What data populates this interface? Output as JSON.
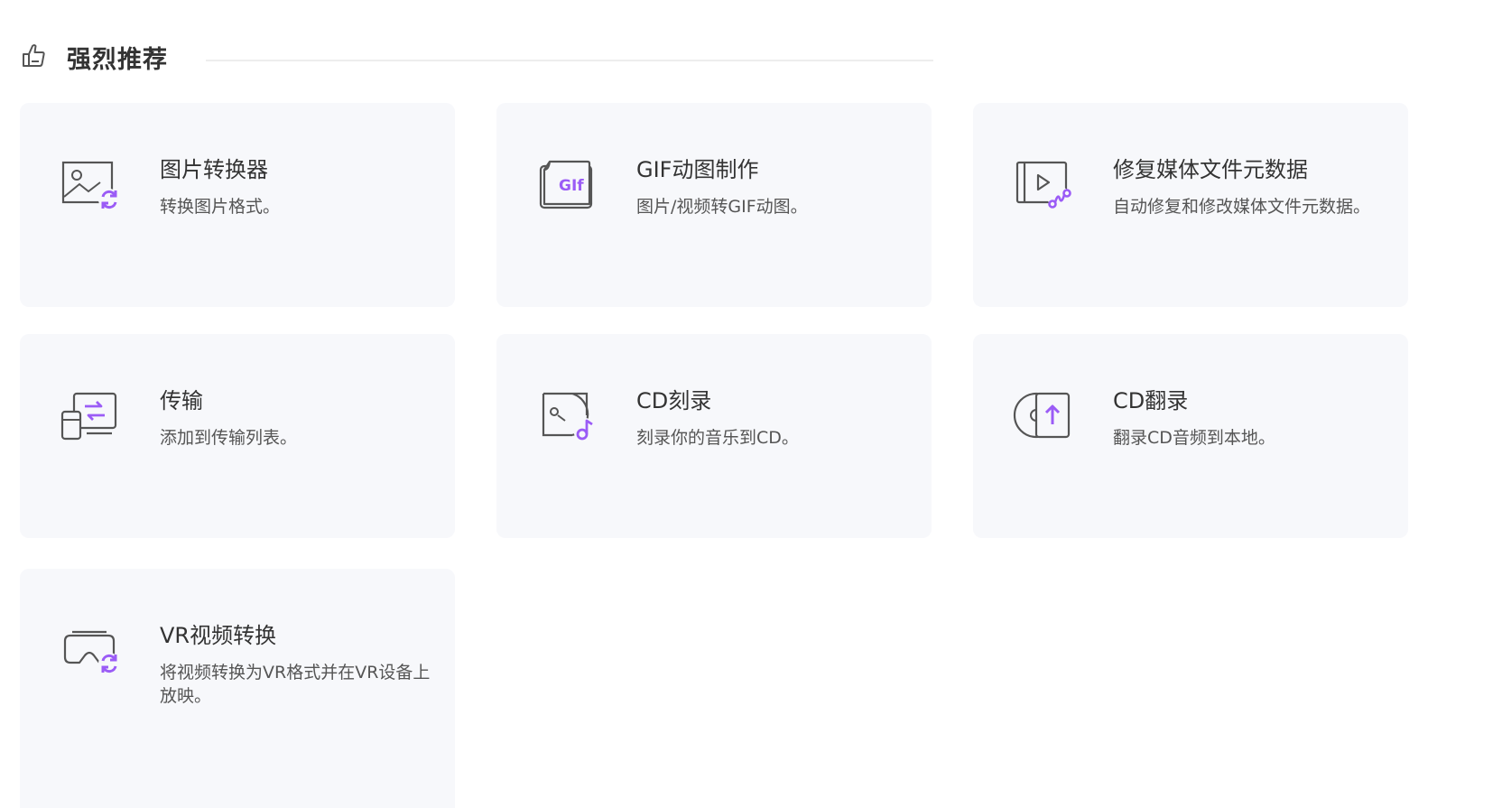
{
  "section": {
    "title": "强烈推荐"
  },
  "colors": {
    "accent": "#9b5cf6",
    "icon_stroke": "#555555",
    "card_bg": "#f7f8fb"
  },
  "tools": [
    {
      "name": "图片转换器",
      "desc": "转换图片格式。",
      "icon": "image-convert-icon"
    },
    {
      "name": "GIF动图制作",
      "desc": "图片/视频转GIF动图。",
      "icon": "gif-maker-icon",
      "icon_text": "GIf"
    },
    {
      "name": "修复媒体文件元数据",
      "desc": "自动修复和修改媒体文件元数据。",
      "icon": "metadata-fix-icon"
    },
    {
      "name": "传输",
      "desc": "添加到传输列表。",
      "icon": "transfer-icon"
    },
    {
      "name": "CD刻录",
      "desc": "刻录你的音乐到CD。",
      "icon": "cd-burn-icon"
    },
    {
      "name": "CD翻录",
      "desc": "翻录CD音频到本地。",
      "icon": "cd-rip-icon"
    },
    {
      "name": "VR视频转换",
      "desc": "将视频转换为VR格式并在VR设备上放映。",
      "icon": "vr-convert-icon"
    }
  ]
}
